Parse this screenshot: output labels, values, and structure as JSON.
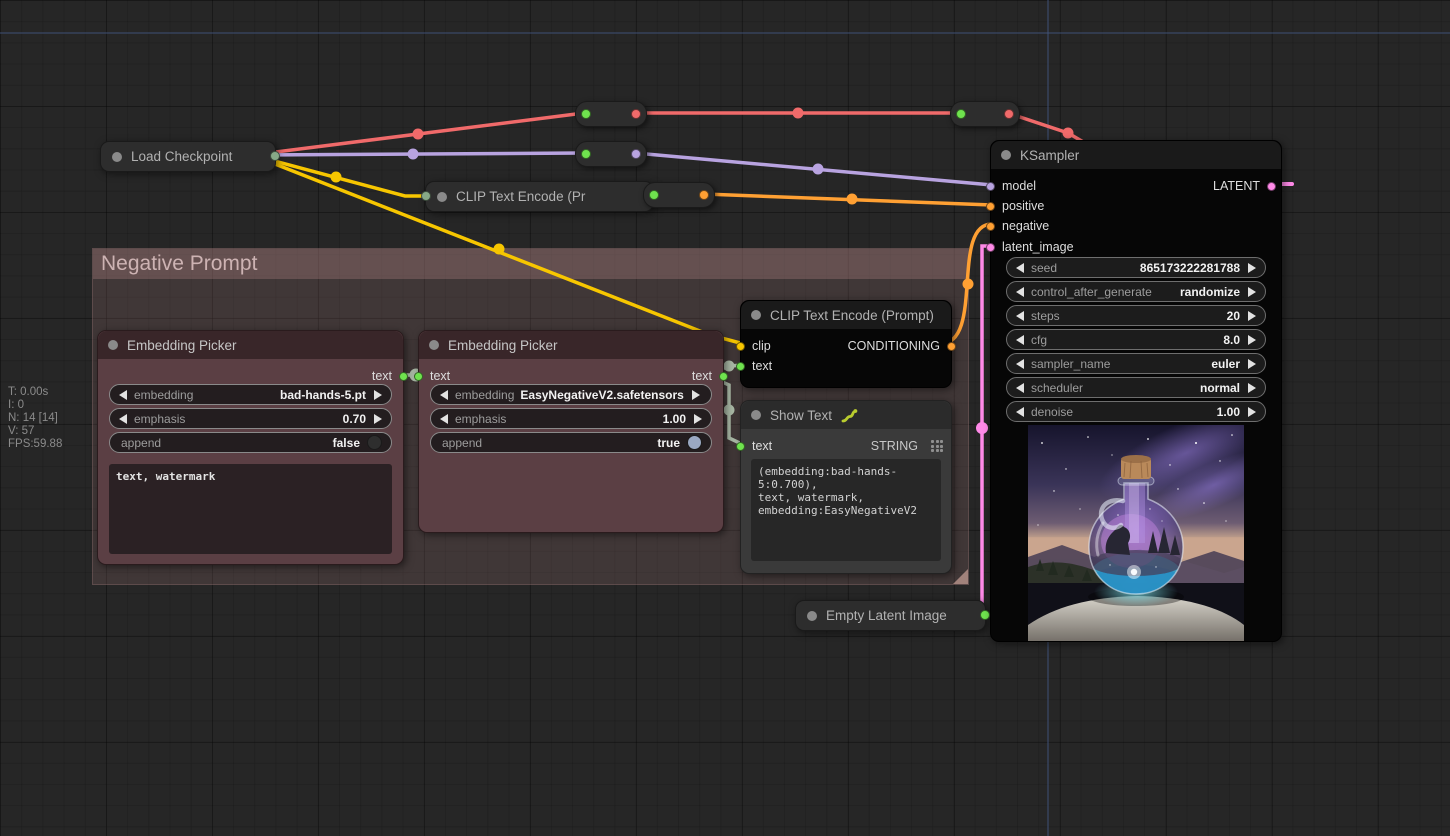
{
  "canvas": {
    "stats": [
      "T: 0.00s",
      "I: 0",
      "N: 14 [14]",
      "V: 57",
      "FPS:59.88"
    ]
  },
  "group": {
    "title": "Negative Prompt"
  },
  "link_colors": {
    "model": "#b8a3e0",
    "clip": "#f7c600",
    "vae": "#f06a6a",
    "conditioning": "#ffa033",
    "latent": "#ff8ae8",
    "text": "#a9b8a5"
  },
  "nodes": {
    "load_checkpoint": {
      "title": "Load Checkpoint"
    },
    "clip_text_encode_collapsed": {
      "title": "CLIP Text Encode (Pr"
    },
    "embedding_picker_1": {
      "title": "Embedding Picker",
      "output_label": "text",
      "widgets": [
        {
          "label": "embedding",
          "value": "bad-hands-5.pt"
        },
        {
          "label": "emphasis",
          "value": "0.70"
        },
        {
          "label": "append",
          "value": "false"
        }
      ],
      "text": "text, watermark"
    },
    "embedding_picker_2": {
      "title": "Embedding Picker",
      "input_label": "text",
      "output_label": "text",
      "widgets": [
        {
          "label": "embedding",
          "value": "EasyNegativeV2.safetensors"
        },
        {
          "label": "emphasis",
          "value": "1.00"
        },
        {
          "label": "append",
          "value": "true"
        }
      ]
    },
    "clip_text_encode_prompt": {
      "title": "CLIP Text Encode (Prompt)",
      "inputs": [
        "clip",
        "text"
      ],
      "output": "CONDITIONING"
    },
    "show_text": {
      "title": "Show Text",
      "input": "text",
      "output": "STRING",
      "text": "(embedding:bad-hands-5:0.700),\ntext, watermark,\nembedding:EasyNegativeV2"
    },
    "empty_latent_image": {
      "title": "Empty Latent Image"
    },
    "ksampler": {
      "title": "KSampler",
      "inputs": [
        "model",
        "positive",
        "negative",
        "latent_image"
      ],
      "output": "LATENT",
      "widgets": [
        {
          "label": "seed",
          "value": "865173222281788"
        },
        {
          "label": "control_after_generate",
          "value": "randomize"
        },
        {
          "label": "steps",
          "value": "20"
        },
        {
          "label": "cfg",
          "value": "8.0"
        },
        {
          "label": "sampler_name",
          "value": "euler"
        },
        {
          "label": "scheduler",
          "value": "normal"
        },
        {
          "label": "denoise",
          "value": "1.00"
        }
      ],
      "preview_alt": "galaxy inside a corked glass bottle on a rock under a starry night sky"
    }
  }
}
